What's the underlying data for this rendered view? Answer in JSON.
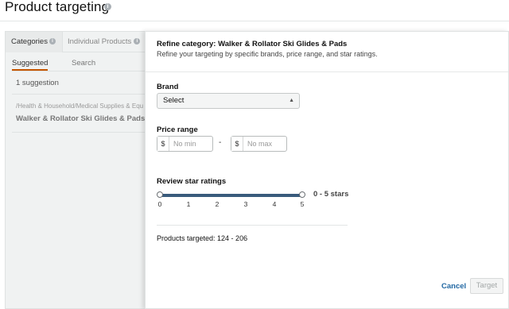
{
  "header": {
    "title": "Product targeting",
    "info_icon": "info-icon"
  },
  "left_panel": {
    "tabs": [
      {
        "label": "Categories",
        "active": true
      },
      {
        "label": "Individual Products",
        "active": false
      }
    ],
    "subtabs": [
      {
        "label": "Suggested",
        "active": true
      },
      {
        "label": "Search",
        "active": false
      }
    ],
    "suggestion_count": "1 suggestion",
    "suggestion": {
      "path": "/Health & Household/Medical Supplies & Equ",
      "name": "Walker & Rollator Ski Glides & Pads"
    }
  },
  "right_panel": {
    "title": "Refine category: Walker & Rollator Ski Glides & Pads",
    "description": "Refine your targeting by specific brands, price range, and star ratings.",
    "brand": {
      "label": "Brand",
      "selected": "Select"
    },
    "price_range": {
      "label": "Price range",
      "currency": "$",
      "min_placeholder": "No min",
      "max_placeholder": "No max",
      "separator": "-"
    },
    "review_ratings": {
      "label": "Review star ratings",
      "value_text": "0 - 5 stars",
      "min": 0,
      "max": 5,
      "ticks": [
        "0",
        "1",
        "2",
        "3",
        "4",
        "5"
      ]
    },
    "products_targeted": "Products targeted: 124 - 206",
    "cancel_label": "Cancel",
    "target_label": "Target"
  },
  "colors": {
    "slider": "#395b7c",
    "link": "#2268a3",
    "active_tab_underline": "#c45500"
  }
}
